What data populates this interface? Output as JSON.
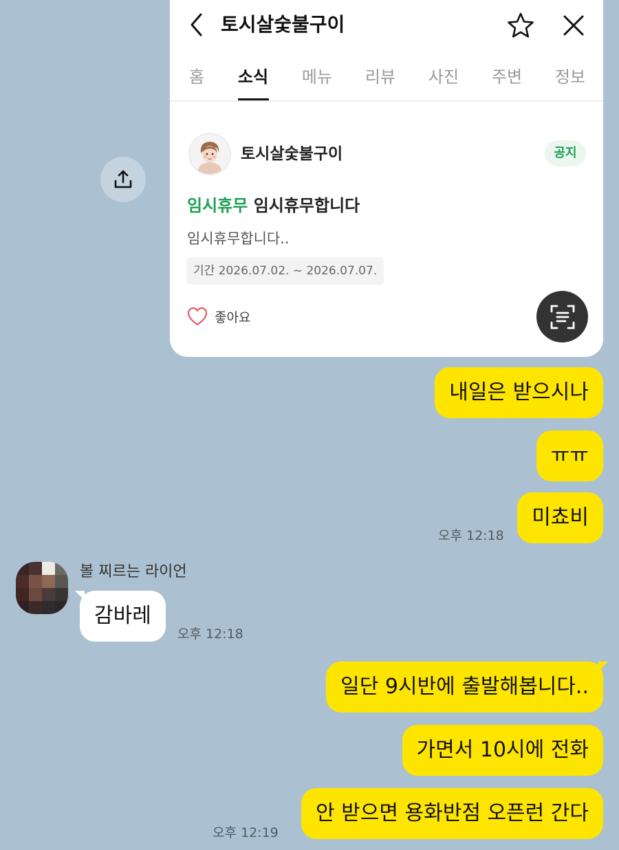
{
  "place_card": {
    "title": "토시살숯불구이",
    "tabs": [
      "홈",
      "소식",
      "메뉴",
      "리뷰",
      "사진",
      "주변",
      "정보"
    ],
    "active_tab": "소식",
    "post": {
      "author": "토시살숯불구이",
      "badge": "공지",
      "tag": "임시휴무",
      "headline": "임시휴무합니다",
      "body": "임시휴무합니다..",
      "period": "기간 2026.07.02. ~ 2026.07.07.",
      "like_label": "좋아요"
    },
    "icons": [
      "back-arrow-icon",
      "star-outline-icon",
      "close-icon",
      "heart-outline-icon",
      "text-scan-icon",
      "share-upload-icon"
    ]
  },
  "chat": {
    "my_messages_1": [
      "내일은 받으시나",
      "ㅠㅠ",
      "미쵸비"
    ],
    "my_time_1": "오후 12:18",
    "friend": {
      "name": "볼 찌르는 라이언",
      "message": "감바레",
      "time": "오후 12:18"
    },
    "my_messages_2": [
      "일단 9시반에 출발해봅니다..",
      "가면서 10시에 전화",
      "안 받으면 용화반점 오픈런 간다"
    ],
    "my_time_2": "오후 12:19"
  },
  "colors": {
    "chat_background": "#abc1d1",
    "my_bubble": "#fee500",
    "their_bubble": "#ffffff",
    "accent_green": "#1aa052"
  }
}
